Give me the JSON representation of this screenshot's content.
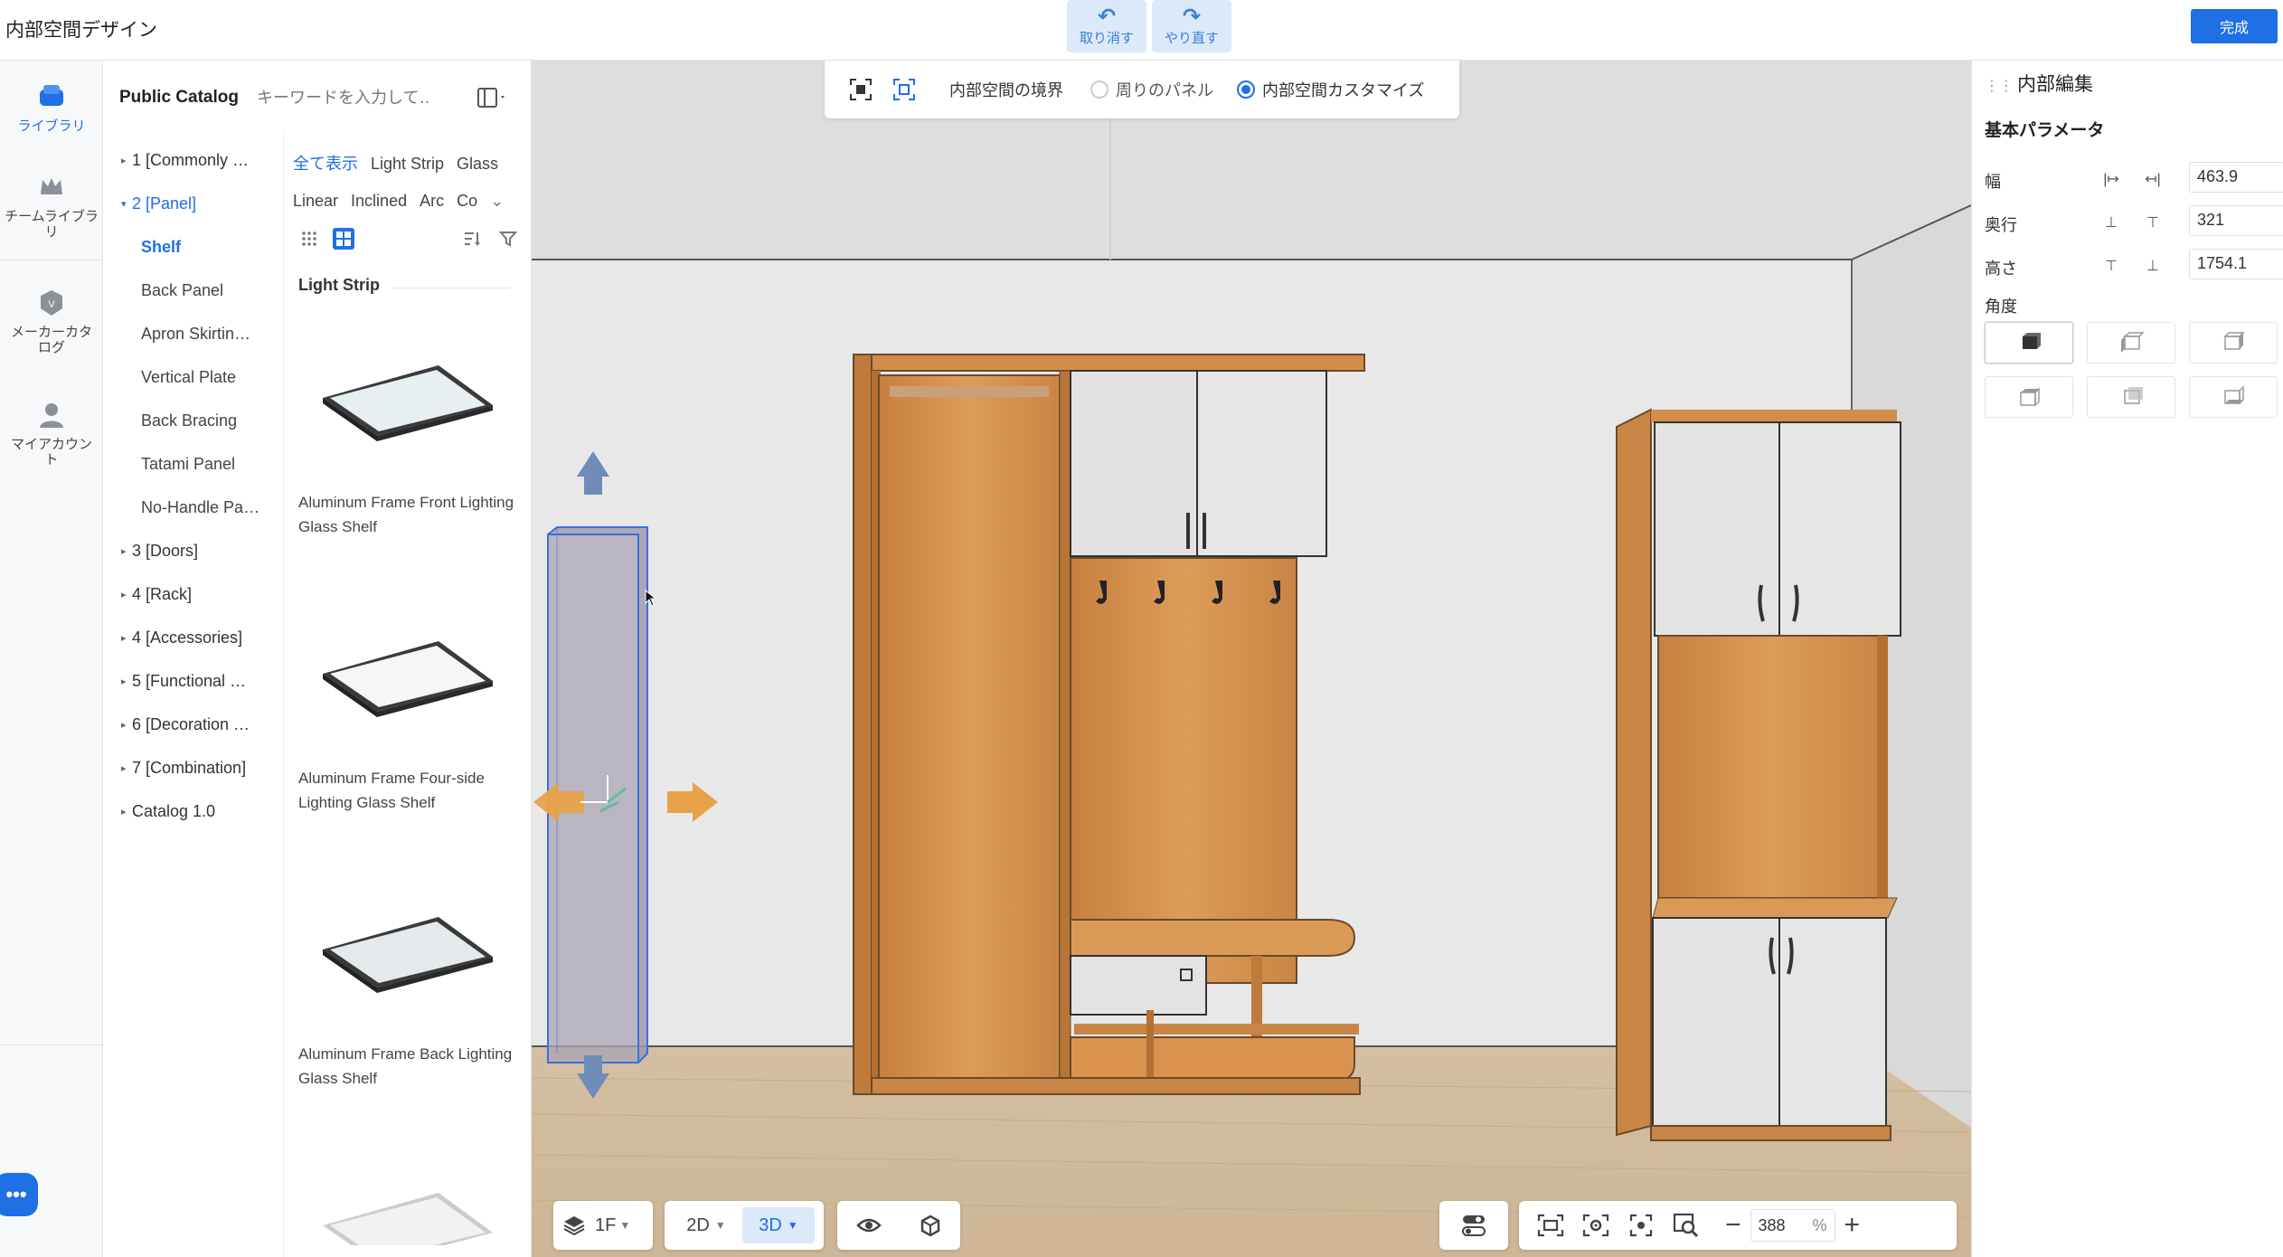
{
  "app": {
    "title": "内部空間デザイン",
    "done_label": "完成"
  },
  "history": {
    "undo_label": "取り消す",
    "redo_label": "やり直す"
  },
  "rail": {
    "items": [
      {
        "label": "ライブラリ",
        "icon": "library-icon",
        "active": true
      },
      {
        "label": "チームライブラリ",
        "icon": "team-library-icon",
        "active": false
      },
      {
        "label": "メーカーカタログ",
        "icon": "maker-catalog-icon",
        "active": false
      },
      {
        "label": "マイアカウント",
        "icon": "account-icon",
        "active": false
      }
    ]
  },
  "catalog": {
    "title": "Public Catalog",
    "search_placeholder": "キーワードを入力して…",
    "tree": [
      {
        "label": "1 [Commonly …",
        "open": false
      },
      {
        "label": "2 [Panel]",
        "open": true
      },
      {
        "label": "3 [Doors]",
        "open": false
      },
      {
        "label": "4 [Rack]",
        "open": false
      },
      {
        "label": "4 [Accessories]",
        "open": false
      },
      {
        "label": "5 [Functional …",
        "open": false
      },
      {
        "label": "6 [Decoration …",
        "open": false
      },
      {
        "label": "7 [Combination]",
        "open": false
      },
      {
        "label": "Catalog 1.0",
        "open": false
      }
    ],
    "panel_children": [
      "Shelf",
      "Back Panel",
      "Apron Skirtin…",
      "Vertical Plate",
      "Back Bracing",
      "Tatami Panel",
      "No-Handle Pa…"
    ],
    "selected_child": "Shelf",
    "filters_row1": [
      "全て表示",
      "Light Strip",
      "Glass"
    ],
    "filters_row2": [
      "Linear",
      "Inclined",
      "Arc",
      "Co"
    ],
    "active_filter": "全て表示",
    "section_label": "Light Strip",
    "products": [
      {
        "name": "Aluminum Frame Front Lighting Glass Shelf"
      },
      {
        "name": "Aluminum Frame Four-side Lighting Glass Shelf"
      },
      {
        "name": "Aluminum Frame Back Lighting Glass Shelf"
      }
    ]
  },
  "boundary_bar": {
    "label": "内部空間の境界",
    "options": [
      {
        "label": "周りのパネル",
        "checked": false
      },
      {
        "label": "内部空間カスタマイズ",
        "checked": true
      }
    ]
  },
  "bottom_bar": {
    "floor": "1F",
    "view_2d": "2D",
    "view_3d": "3D",
    "active_view": "3D",
    "zoom_value": "388",
    "zoom_unit": "%"
  },
  "inspector": {
    "title": "内部編集",
    "section": "基本パラメータ",
    "params": [
      {
        "label": "幅",
        "value": "463.9"
      },
      {
        "label": "奥行",
        "value": "321"
      },
      {
        "label": "高さ",
        "value": "1754.1"
      }
    ],
    "angle_label": "角度"
  },
  "colors": {
    "accent": "#1f6fe5",
    "wood": "#d9944f",
    "door": "#e4e4e4",
    "wall": "#e9e9e9",
    "floor": "#d8c1a2"
  }
}
